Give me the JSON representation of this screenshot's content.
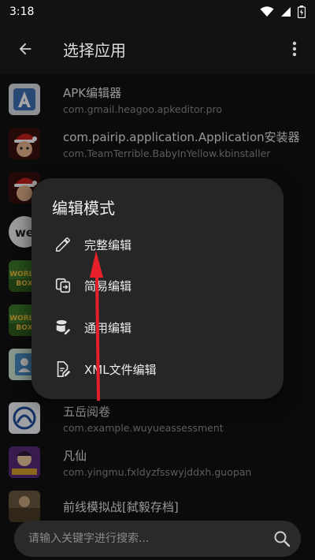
{
  "status_bar": {
    "time": "3:18"
  },
  "header": {
    "title": "选择应用"
  },
  "apps": [
    {
      "name": "APK编辑器",
      "package": "com.gmail.heagoo.apkeditor.pro",
      "icon": "apk-editor-icon"
    },
    {
      "name": "com.pairip.application.Application安装器",
      "package": "com.TeamTerrible.BabyInYellow.kbinstaller",
      "icon": "santa-baby-icon"
    },
    {
      "name": "",
      "package": "",
      "icon": "santa-baby-icon"
    },
    {
      "name": "",
      "package": "",
      "icon": "we-logo-icon"
    },
    {
      "name": "",
      "package": "",
      "icon": "world-box-icon"
    },
    {
      "name": "",
      "package": "",
      "icon": "world-box-icon"
    },
    {
      "name": "",
      "package": "",
      "icon": "contacts-icon"
    },
    {
      "name": "五岳阅卷",
      "package": "com.example.wuyueassessment",
      "icon": "wuyue-icon"
    },
    {
      "name": "凡仙",
      "package": "com.yingmu.fxldyzfsswyjddxh.guopan",
      "icon": "fanxian-game-icon"
    },
    {
      "name": "前线模拟战[弑毅存档]",
      "package": "",
      "icon": "battle-game-icon"
    }
  ],
  "dialog": {
    "title": "编辑模式",
    "items": [
      {
        "label": "完整编辑",
        "icon": "pencil-icon"
      },
      {
        "label": "简易编辑",
        "icon": "copy-swap-icon"
      },
      {
        "label": "通用编辑",
        "icon": "database-edit-icon"
      },
      {
        "label": "XML文件编辑",
        "icon": "file-edit-icon"
      }
    ]
  },
  "search": {
    "placeholder": "请输入关键字进行搜索..."
  },
  "colors": {
    "background": "#121212",
    "dialog": "#262626",
    "arrow": "#e5202a"
  }
}
